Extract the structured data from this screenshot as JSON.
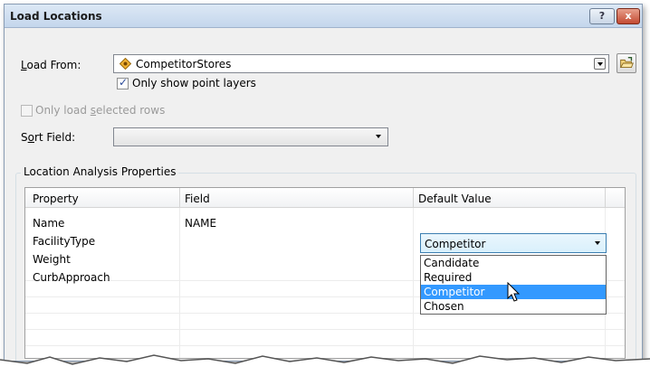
{
  "window": {
    "title": "Load Locations",
    "help_button": "?",
    "close_button": "x"
  },
  "load_from": {
    "label_prefix": "L",
    "label_rest": "oad From:",
    "value": "CompetitorStores",
    "icon": "point-layer-icon"
  },
  "only_point_layers": {
    "checked": true,
    "label": "Only show point layers"
  },
  "only_selected_rows": {
    "checked": false,
    "enabled": false,
    "label_before": "Only load ",
    "label_underlined": "s",
    "label_after": "elected rows"
  },
  "sort_field": {
    "label_before": "S",
    "label_underlined": "o",
    "label_after": "rt Field:",
    "value": ""
  },
  "group": {
    "title": "Location Analysis Properties",
    "columns": [
      "Property",
      "Field",
      "Default Value"
    ],
    "rows": [
      {
        "property": "Name",
        "field": "NAME",
        "default_value": ""
      },
      {
        "property": "FacilityType",
        "field": "",
        "default_value": "Competitor"
      },
      {
        "property": "Weight",
        "field": "",
        "default_value": ""
      },
      {
        "property": "CurbApproach",
        "field": "",
        "default_value": ""
      }
    ]
  },
  "dropdown": {
    "selected": "Competitor",
    "options": [
      "Candidate",
      "Required",
      "Competitor",
      "Chosen"
    ],
    "highlighted_index": 2
  },
  "colors": {
    "selection": "#3399ff",
    "title_gradient_top": "#dce8f5",
    "close_button": "#c34a32"
  }
}
